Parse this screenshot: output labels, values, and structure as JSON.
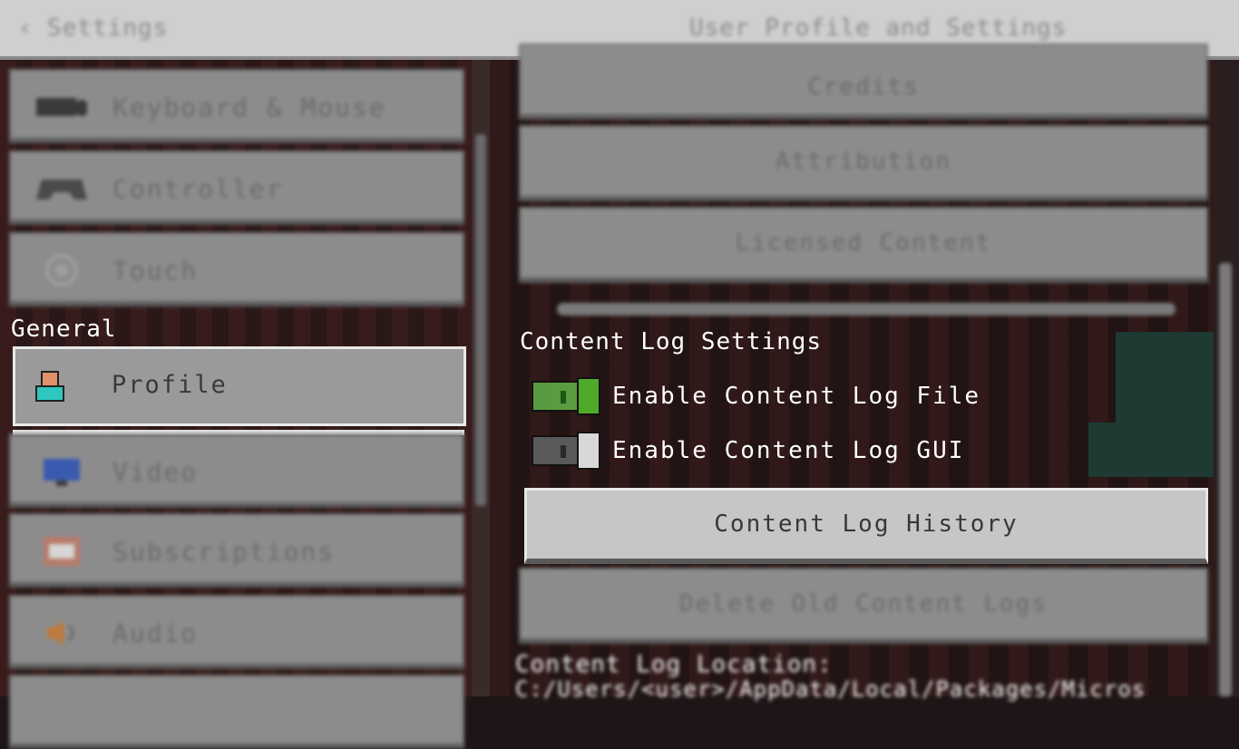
{
  "header": {
    "back_icon": "‹",
    "back_label": "Settings",
    "title": "User Profile and Settings"
  },
  "sidebar": {
    "items_top": [
      {
        "label": "Keyboard & Mouse",
        "icon": "keyboard-icon"
      },
      {
        "label": "Controller",
        "icon": "controller-icon"
      },
      {
        "label": "Touch",
        "icon": "touch-icon"
      }
    ],
    "section_label": "General",
    "selected": {
      "label": "Profile",
      "icon": "profile-icon"
    },
    "items_bottom": [
      {
        "label": "Video",
        "icon": "monitor-icon"
      },
      {
        "label": "Subscriptions",
        "icon": "subscriptions-icon"
      },
      {
        "label": "Audio",
        "icon": "speaker-icon"
      }
    ]
  },
  "right": {
    "buttons_top": [
      "Credits",
      "Attribution",
      "Licensed Content"
    ],
    "section_title": "Content Log Settings",
    "toggles": [
      {
        "label": "Enable Content Log File",
        "on": true
      },
      {
        "label": "Enable Content Log GUI",
        "on": false
      }
    ],
    "history_button": "Content Log History",
    "delete_button": "Delete Old Content Logs",
    "log_location_label": "Content Log Location:",
    "log_location_path": "C:/Users/<user>/AppData/Local/Packages/Micros"
  },
  "colors": {
    "toggle_on": "#4faa2a",
    "selected_border": "#e8e8e8",
    "profile_head": "#e0906a",
    "profile_body": "#2ec7c0"
  }
}
